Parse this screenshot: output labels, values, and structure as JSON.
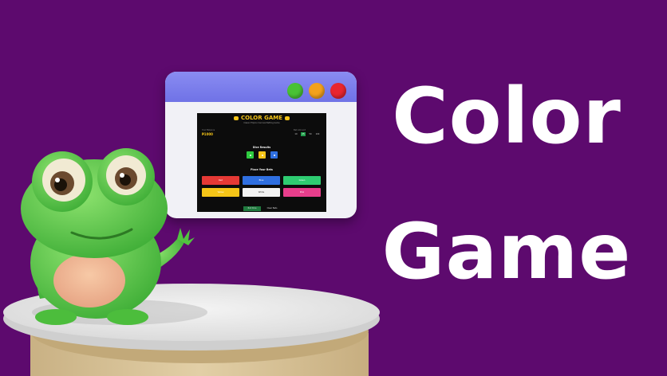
{
  "banner": {
    "title_line1": "Color",
    "title_line2": "Game"
  },
  "colors": {
    "background": "#5d0a6e",
    "browser_bar": "#7a7cee",
    "frog": "#5fd44a",
    "platform_top": "#e6e6e6",
    "platform_base": "#d8c49a"
  },
  "browser": {
    "controls": [
      "green-dot",
      "orange-dot",
      "red-dot"
    ]
  },
  "game": {
    "title": "COLOR GAME",
    "subtitle": "Classic Filipino Carnival Betting Game",
    "balance_label": "Your Balance",
    "balance": "₱1000",
    "bet_label": "Bet Amount",
    "chips": [
      {
        "label": "10",
        "active": false
      },
      {
        "label": "25",
        "active": true
      },
      {
        "label": "50",
        "active": false
      },
      {
        "label": "100",
        "active": false
      }
    ],
    "dice_title": "Dice Results",
    "dice": [
      "#2ecc40",
      "#f5c518",
      "#2f6fe0"
    ],
    "bets_title": "Place Your Bets",
    "bets": [
      {
        "label": "Red",
        "color": "#e53935"
      },
      {
        "label": "Blue",
        "color": "#2f6fe0"
      },
      {
        "label": "Green",
        "color": "#2ecc71"
      },
      {
        "label": "Yellow",
        "color": "#f5c518"
      },
      {
        "label": "White",
        "color": "#f2f2f2"
      },
      {
        "label": "Pink",
        "color": "#e83e8c"
      }
    ],
    "roll_button": "Roll Dice",
    "clear_button": "Clear Bets"
  }
}
